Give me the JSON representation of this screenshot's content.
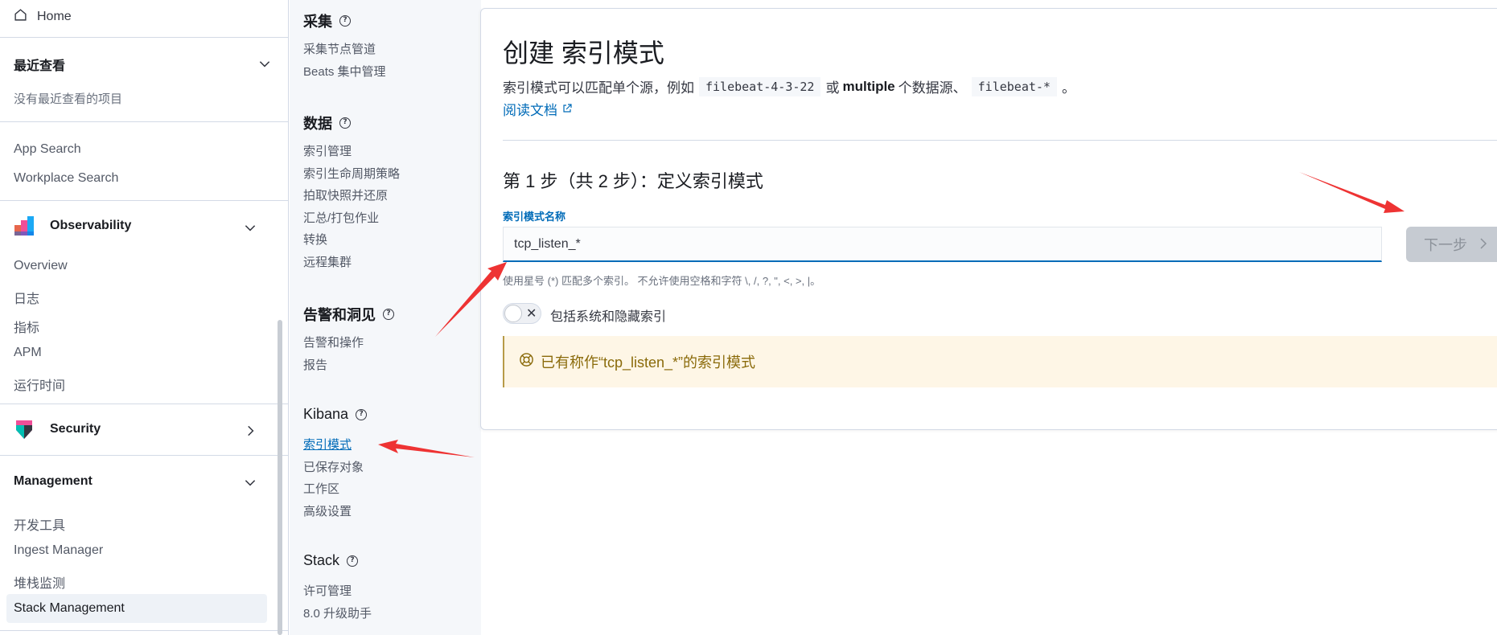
{
  "left_nav": {
    "home_label": "Home",
    "recent": {
      "title": "最近查看",
      "empty_text": "没有最近查看的项目"
    },
    "enterprise_links": [
      "App Search",
      "Workplace Search"
    ],
    "observability": {
      "title": "Observability",
      "items": [
        "Overview",
        "日志",
        "指标",
        "APM",
        "运行时间"
      ]
    },
    "security": {
      "title": "Security"
    },
    "management": {
      "title": "Management",
      "items": [
        "开发工具",
        "Ingest Manager",
        "堆栈监测",
        "Stack Management"
      ]
    }
  },
  "mid_nav": {
    "sections": [
      {
        "title": "采集",
        "items": [
          "采集节点管道",
          "Beats 集中管理"
        ]
      },
      {
        "title": "数据",
        "items": [
          "索引管理",
          "索引生命周期策略",
          "拍取快照并还原",
          "汇总/打包作业",
          "转换",
          "远程集群"
        ]
      },
      {
        "title": "告警和洞见",
        "items": [
          "告警和操作",
          "报告"
        ]
      },
      {
        "title": "Kibana",
        "items": [
          "索引模式",
          "已保存对象",
          "工作区",
          "高级设置"
        ]
      },
      {
        "title": "Stack",
        "items": [
          "许可管理",
          "8.0 升级助手"
        ]
      }
    ],
    "active_item": "索引模式"
  },
  "main": {
    "title": "创建 索引模式",
    "desc_part1": "索引模式可以匹配单个源，例如",
    "code1": "filebeat-4-3-22",
    "desc_part2": "或",
    "desc_bold": "multiple",
    "desc_part3": "个数据源、",
    "code2": "filebeat-*",
    "desc_part4": "。",
    "doc_link": "阅读文档",
    "step_title": "第 1 步（共 2 步）：定义索引模式",
    "field_label": "索引模式名称",
    "field_value": "tcp_listen_*",
    "next_button": "下一步",
    "help_text": "使用星号 (*) 匹配多个索引。 不允许使用空格和字符 \\, /, ?, \", <, >, |。",
    "toggle_label": "包括系统和隐藏索引",
    "callout_text": "已有称作“tcp_listen_*”的索引模式"
  },
  "colors": {
    "link": "#006bb8",
    "callout_bg": "#fef6e6",
    "callout_text": "#8a6a0a",
    "arrow": "#ee3333"
  }
}
